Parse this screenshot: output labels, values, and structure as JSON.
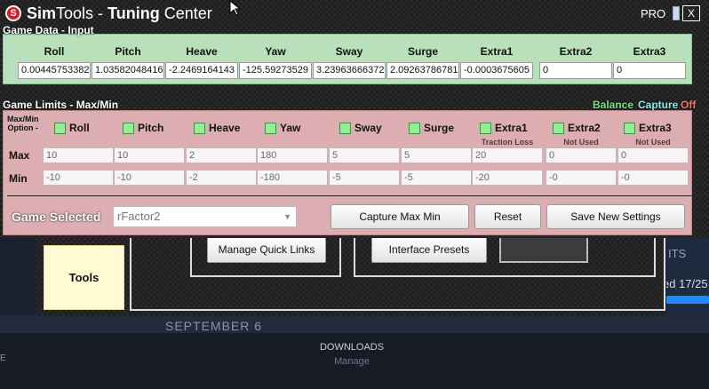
{
  "window": {
    "title_bold": "Sim",
    "title_mid": "Tools - ",
    "title_end": "Tuning",
    "title_tail": " Center",
    "pro_label": "PRO",
    "close_label": "X"
  },
  "game_data": {
    "title": "Game Data - Input",
    "columns": [
      "Roll",
      "Pitch",
      "Heave",
      "Yaw",
      "Sway",
      "Surge",
      "Extra1",
      "Extra2",
      "Extra3"
    ],
    "values": [
      "0.00445753382",
      "1.03582048416",
      "-2.2469164143",
      "-125.59273529",
      "3.23963666372",
      "2.09263786781",
      "-0.0003675605",
      "0",
      "0"
    ]
  },
  "game_limits": {
    "title": "Game Limits - Max/Min",
    "balance": "Balance",
    "capture": "Capture",
    "off": "Off",
    "option_label_1": "Max/Min",
    "option_label_2": "Option -",
    "options": [
      "Roll",
      "Pitch",
      "Heave",
      "Yaw",
      "Sway",
      "Surge",
      "Extra1",
      "Extra2",
      "Extra3"
    ],
    "notes": [
      "",
      "",
      "",
      "",
      "",
      "",
      "Traction Loss",
      "Not Used",
      "Not Used"
    ],
    "max_label": "Max",
    "min_label": "Min",
    "max": [
      "10",
      "10",
      "2",
      "180",
      "5",
      "5",
      "20",
      "0",
      "0"
    ],
    "min": [
      "-10",
      "-10",
      "-2",
      "-180",
      "-5",
      "-5",
      "-20",
      "-0",
      "-0"
    ]
  },
  "footer": {
    "game_selected_label": "Game Selected",
    "game_value": "rFactor2",
    "capture_button": "Capture Max Min",
    "reset_button": "Reset",
    "save_button": "Save New Settings"
  },
  "lower": {
    "tools_label": "Tools",
    "quick_links": "Manage Quick Links",
    "presets": "Interface Presets"
  },
  "background": {
    "date": "SEPTEMBER 6",
    "downloads": "DOWNLOADS",
    "manage": "Manage",
    "its": "ITS",
    "ed": "ed 17/25",
    "edge_letter": "E"
  },
  "colors": {
    "input_panel": "#b7e0bb",
    "limits_panel": "#dcaeb2",
    "balance": "#7fe07f",
    "capture": "#8fe7f0",
    "off": "#ff7070"
  }
}
